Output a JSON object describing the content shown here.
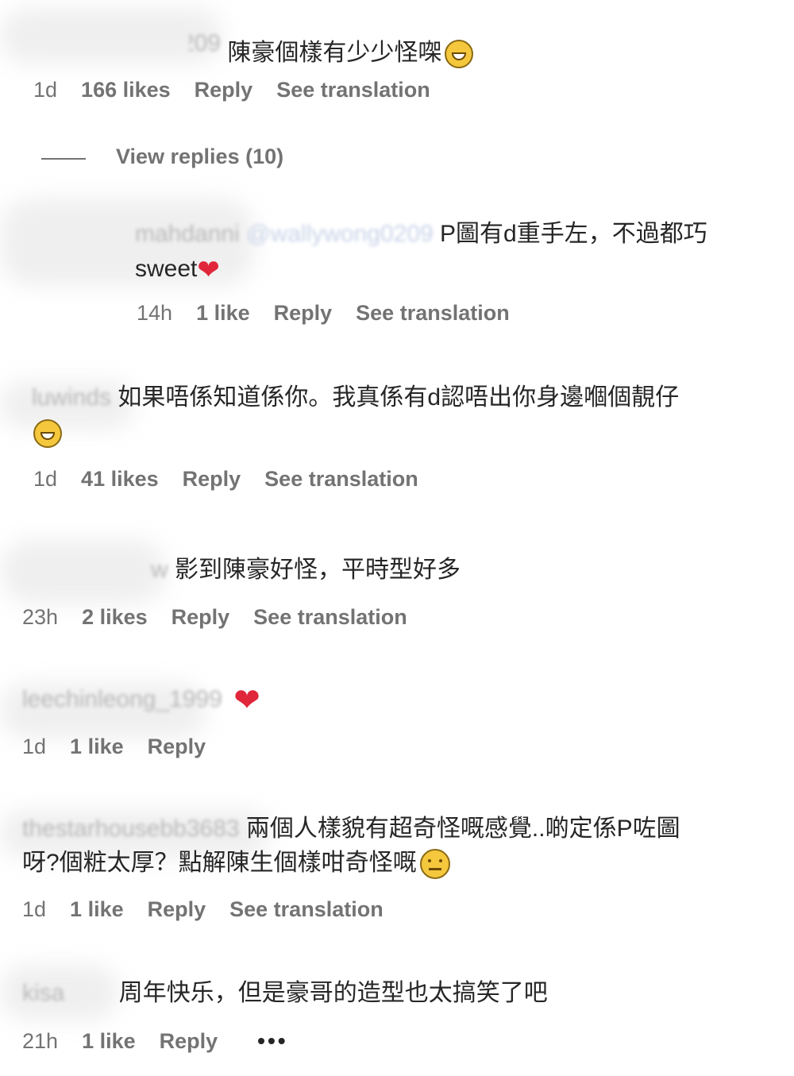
{
  "comments": [
    {
      "username": "wallywong0209",
      "text": "陳豪個樣有少少怪㗎",
      "time": "1d",
      "likes": "166 likes",
      "reply": "Reply",
      "translate": "See translation",
      "emoji": "laughing-tears"
    },
    {
      "view_replies": "View replies (10)"
    },
    {
      "username": "mahdanni",
      "mention": "@wallywong0209",
      "text": "P圖有d重手左，不過都巧",
      "text2": "sweet",
      "time": "14h",
      "likes": "1 like",
      "reply": "Reply",
      "translate": "See translation",
      "emoji": "heart"
    },
    {
      "username": "luwinds",
      "text": "如果唔係知道係你。我真係有d認唔出你身邊嗰個靚仔",
      "time": "1d",
      "likes": "41 likes",
      "reply": "Reply",
      "translate": "See translation",
      "emoji": "laughing-tears"
    },
    {
      "username": "w",
      "text": "影到陳豪好怪，平時型好多",
      "time": "23h",
      "likes": "2 likes",
      "reply": "Reply",
      "translate": "See translation"
    },
    {
      "username": "leechinleong_1999",
      "time": "1d",
      "likes": "1 like",
      "reply": "Reply",
      "emoji": "red-heart"
    },
    {
      "username": "thestarhousebb3683",
      "text": "兩個人樣貌有超奇怪嘅感覺..啲定係P咗圖",
      "text2": "呀?個粧太厚？點解陳生個樣咁奇怪嘅",
      "time": "1d",
      "likes": "1 like",
      "reply": "Reply",
      "translate": "See translation",
      "emoji": "neutral-face"
    },
    {
      "username": "kisa",
      "text": "周年快乐，但是豪哥的造型也太搞笑了吧",
      "time": "21h",
      "likes": "1 like",
      "reply": "Reply",
      "more": "•••"
    }
  ]
}
